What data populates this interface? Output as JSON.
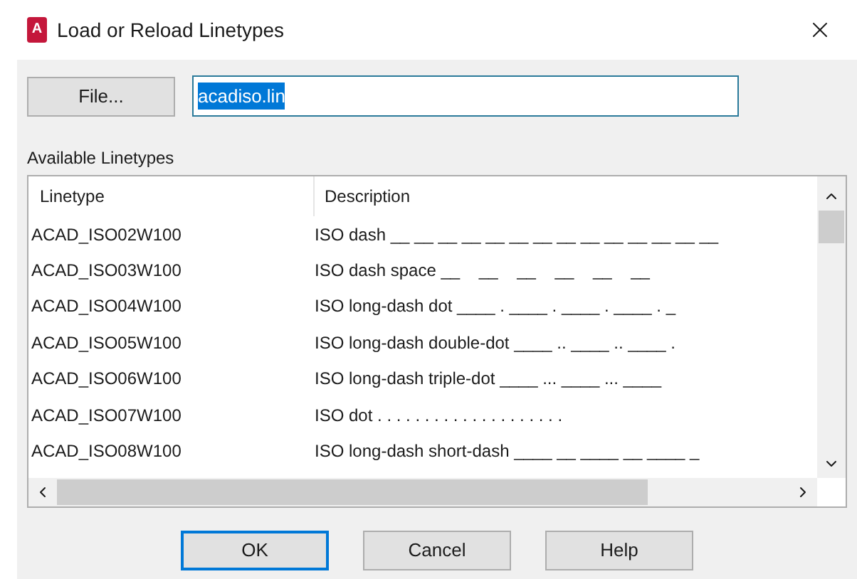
{
  "window": {
    "title": "Load or Reload Linetypes",
    "app_badge": "A"
  },
  "file_button": "File...",
  "file_field": {
    "value": "acadiso.lin",
    "selected": true
  },
  "list_label": "Available Linetypes",
  "table": {
    "columns": [
      "Linetype",
      "Description"
    ],
    "rows": [
      {
        "linetype": "ACAD_ISO02W100",
        "description": "ISO dash __ __ __ __ __ __ __ __ __ __ __ __ __ __"
      },
      {
        "linetype": "ACAD_ISO03W100",
        "description": "ISO dash space __    __    __    __    __    __"
      },
      {
        "linetype": "ACAD_ISO04W100",
        "description": "ISO long-dash dot ____ . ____ . ____ . ____ . _"
      },
      {
        "linetype": "ACAD_ISO05W100",
        "description": "ISO long-dash double-dot ____ .. ____ .. ____ ."
      },
      {
        "linetype": "ACAD_ISO06W100",
        "description": "ISO long-dash triple-dot ____ ... ____ ... ____"
      },
      {
        "linetype": "ACAD_ISO07W100",
        "description": "ISO dot . . . . . . . . . . . . . . . . . . . ."
      },
      {
        "linetype": "ACAD_ISO08W100",
        "description": "ISO long-dash short-dash ____ __ ____ __ ____ _"
      }
    ]
  },
  "buttons": [
    {
      "label": "OK",
      "selected": true
    },
    {
      "label": "Cancel",
      "selected": false
    },
    {
      "label": "Help",
      "selected": false
    }
  ]
}
